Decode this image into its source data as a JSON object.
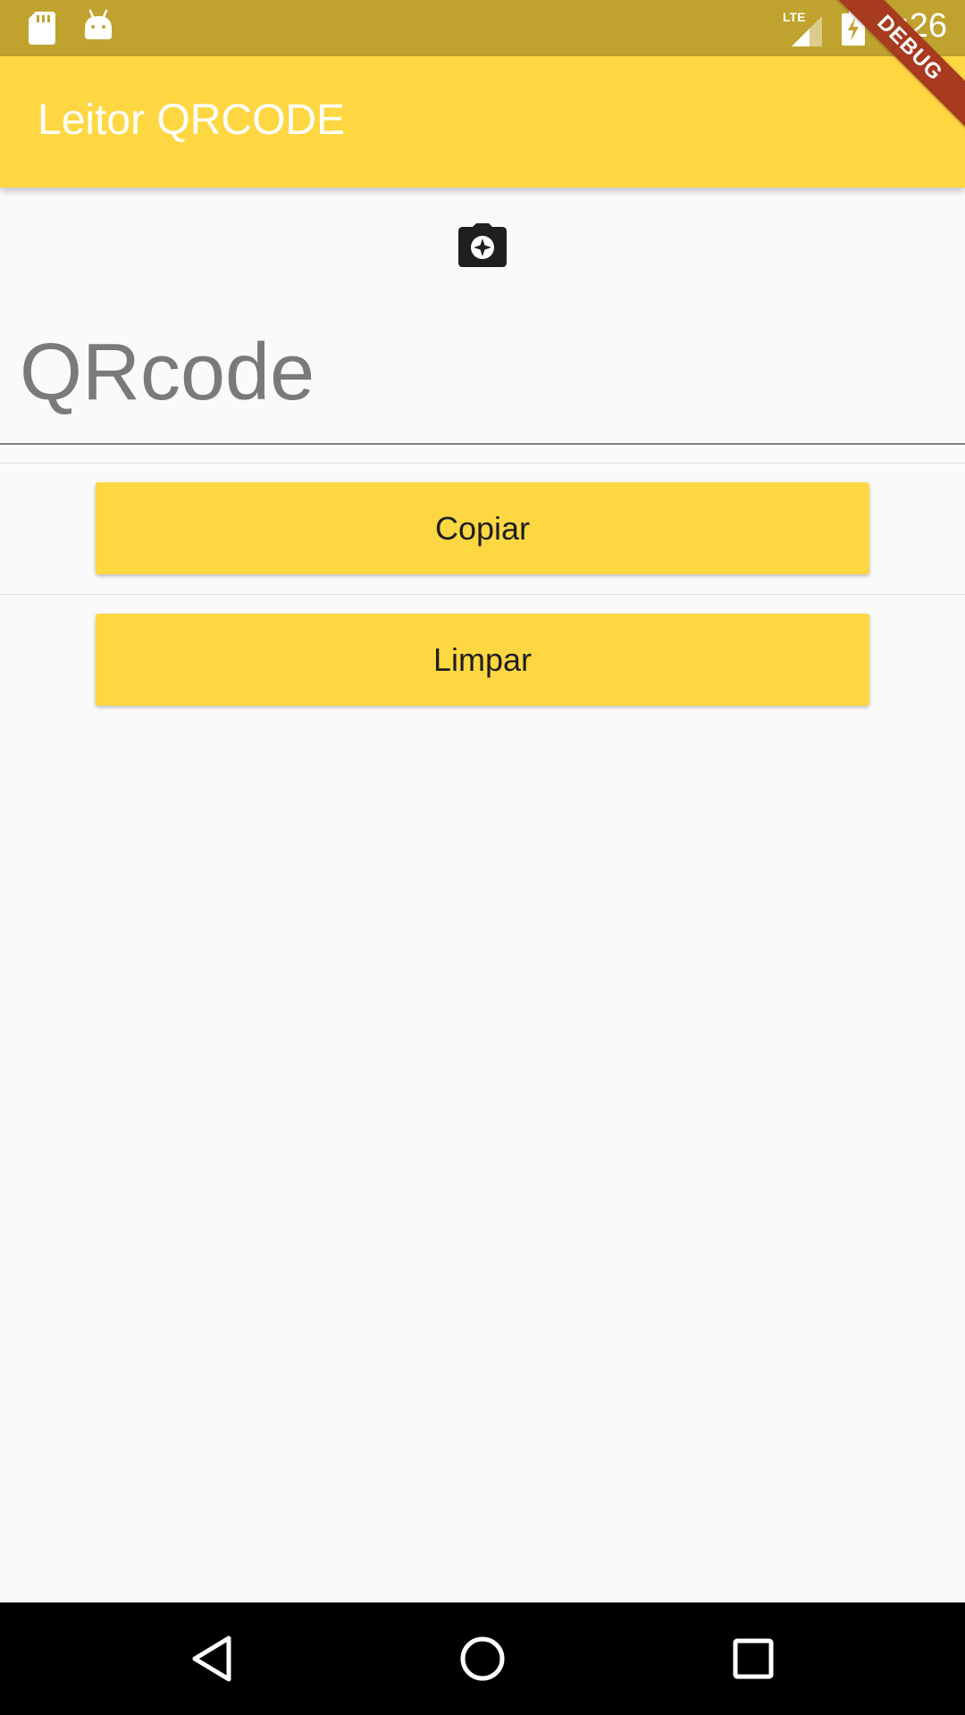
{
  "status_bar": {
    "time": "9:26",
    "icons": [
      "sd-card-icon",
      "android-icon",
      "lte-signal-icon",
      "battery-charging-icon"
    ],
    "background": "#c0a22f"
  },
  "debug_banner": {
    "label": "DEBUG",
    "color": "#a83a1f"
  },
  "app_bar": {
    "title": "Leitor QRCODE",
    "background": "#fed742"
  },
  "scan": {
    "icon": "camera-icon"
  },
  "qr_field": {
    "value": "",
    "placeholder": "QRcode"
  },
  "buttons": {
    "copy_label": "Copiar",
    "clear_label": "Limpar",
    "background": "#fed742"
  },
  "nav_bar": {
    "icons": [
      "back-icon",
      "home-icon",
      "recents-icon"
    ]
  }
}
